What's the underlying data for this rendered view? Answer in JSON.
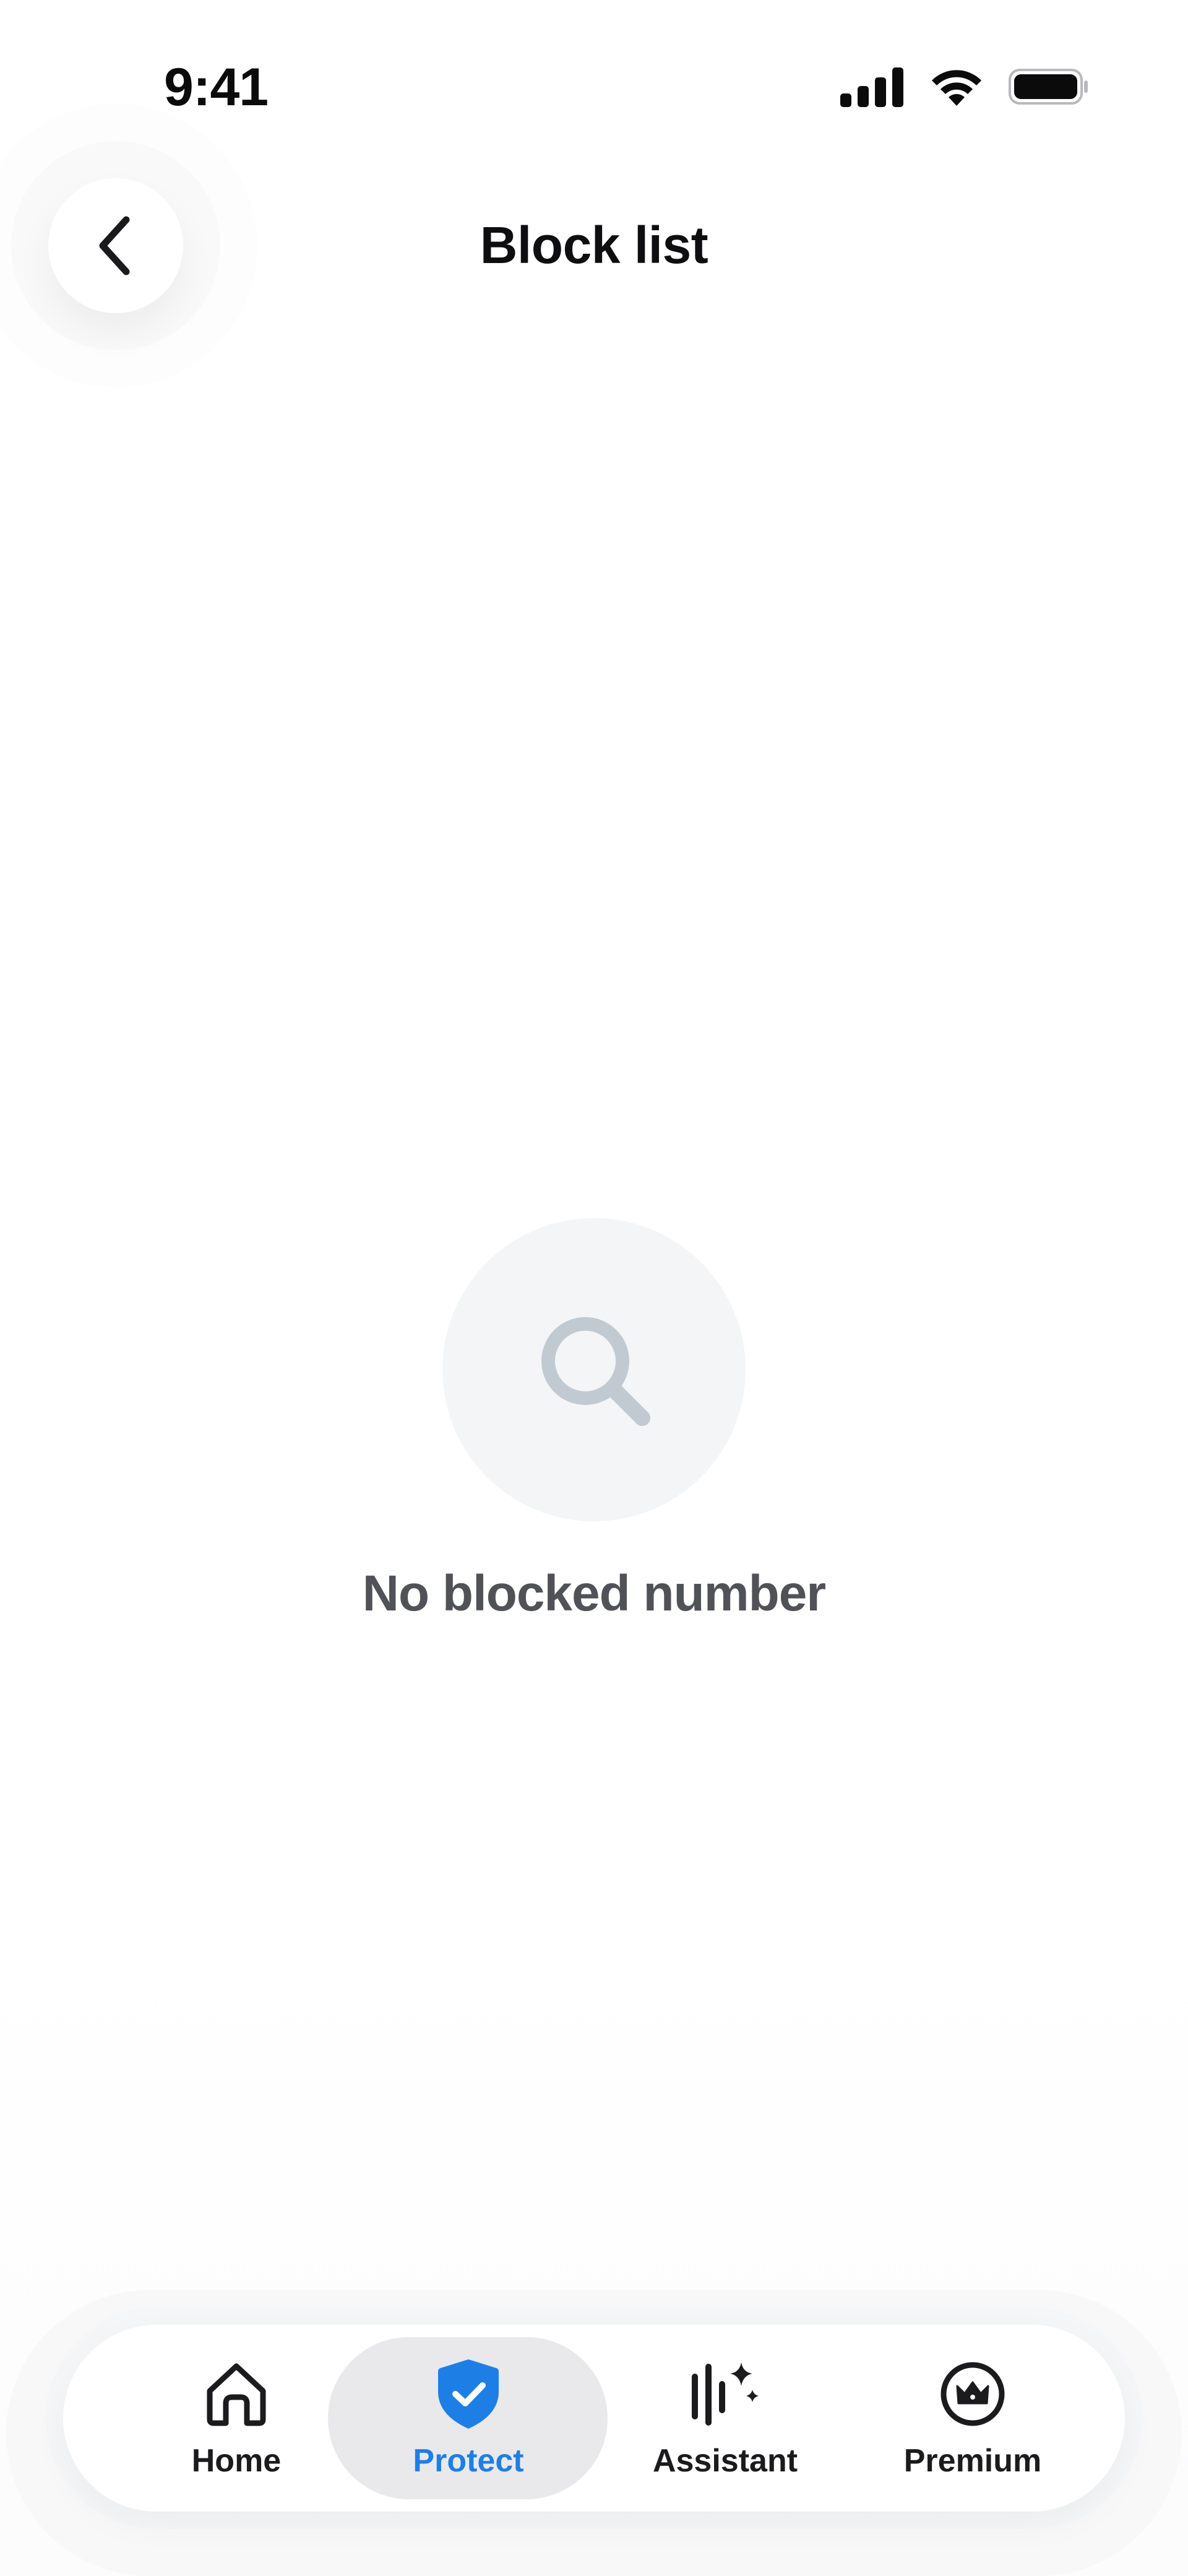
{
  "status_bar": {
    "time": "9:41"
  },
  "header": {
    "title": "Block list",
    "back_icon": "chevron-left-icon"
  },
  "empty_state": {
    "icon": "search-icon",
    "message": "No blocked number"
  },
  "bottom_nav": {
    "active": "Protect",
    "items": [
      {
        "label": "Home",
        "icon": "home-icon"
      },
      {
        "label": "Protect",
        "icon": "shield-check-icon"
      },
      {
        "label": "Assistant",
        "icon": "assistant-sparkle-icon"
      },
      {
        "label": "Premium",
        "icon": "crown-icon"
      }
    ]
  },
  "colors": {
    "accent": "#1d7fe6",
    "empty_circle": "#f3f5f7",
    "search_icon": "#c2cad1",
    "empty_text": "#505257",
    "active_pill": "#e9e9eb"
  }
}
